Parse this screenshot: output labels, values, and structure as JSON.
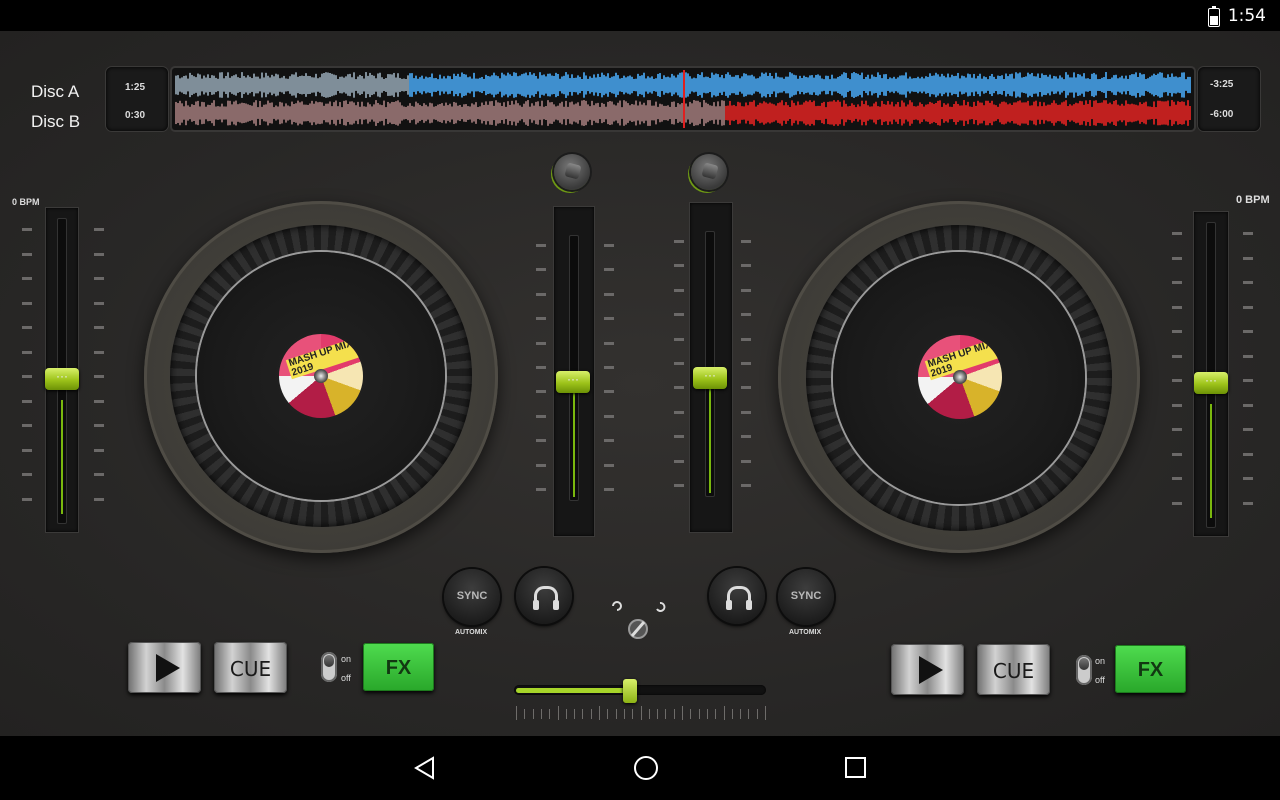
{
  "status_bar": {
    "time": "1:54",
    "battery_icon": "battery-charging-icon"
  },
  "decks_header": {
    "disc_a_label": "Disc A",
    "disc_b_label": "Disc B",
    "disc_a_elapsed": "1:25",
    "disc_b_elapsed": "0:30",
    "disc_a_remaining": "-3:25",
    "disc_b_remaining": "-6:00",
    "disc_a_progress": 0.23,
    "disc_b_progress": 0.54,
    "colors": {
      "disc_a": "#3f8fce",
      "disc_b": "#c0201f",
      "playhead": "#e02020"
    }
  },
  "deck_left": {
    "bpm": "0 BPM",
    "pitch_level": 0.5,
    "record_label": "MASH UP MIX 2019",
    "play_icon": "play-icon",
    "cue_label": "CUE",
    "fx_label": "FX",
    "toggle_on": "on",
    "toggle_off": "off",
    "sync_label": "SYNC",
    "automix_label": "AUTOMIX",
    "headphone_icon": "headphones-icon"
  },
  "deck_right": {
    "bpm": "0 BPM",
    "pitch_level": 0.5,
    "record_label": "MASH UP MIX 2019",
    "play_icon": "play-icon",
    "cue_label": "CUE",
    "fx_label": "FX",
    "toggle_on": "on",
    "toggle_off": "off",
    "sync_label": "SYNC",
    "automix_label": "AUTOMIX",
    "headphone_icon": "headphones-icon"
  },
  "mixer": {
    "channel_a_volume": 0.5,
    "channel_b_volume": 0.5,
    "crossfader": 0.45,
    "reset_icon": "crossfader-reset-icon"
  },
  "accent_color": "#9dc31a",
  "nav_bar": {
    "back_icon": "back-icon",
    "home_icon": "home-icon",
    "recents_icon": "recents-icon"
  }
}
